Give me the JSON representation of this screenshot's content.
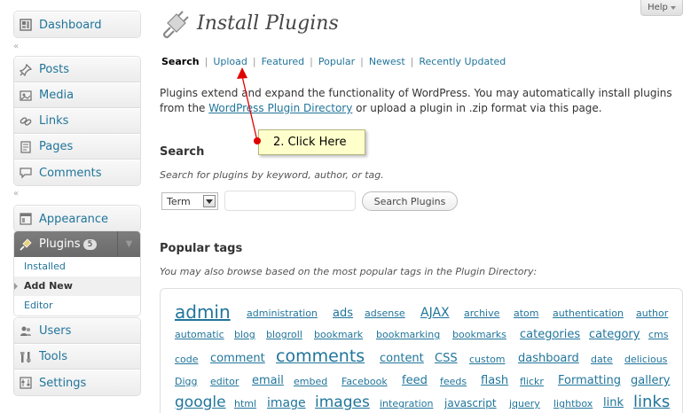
{
  "sidebar": {
    "top": {
      "label": "Dashboard",
      "icon": "dashboard-icon"
    },
    "content": [
      {
        "label": "Posts",
        "icon": "pin-icon"
      },
      {
        "label": "Media",
        "icon": "media-icon"
      },
      {
        "label": "Links",
        "icon": "link-icon"
      },
      {
        "label": "Pages",
        "icon": "page-icon"
      },
      {
        "label": "Comments",
        "icon": "comment-icon"
      }
    ],
    "appearance": {
      "label": "Appearance",
      "icon": "appearance-icon"
    },
    "plugins": {
      "label": "Plugins",
      "icon": "plug-icon",
      "badge": "5",
      "submenu": [
        {
          "label": "Installed"
        },
        {
          "label": "Add New"
        },
        {
          "label": "Editor"
        }
      ]
    },
    "bottom": [
      {
        "label": "Users",
        "icon": "users-icon"
      },
      {
        "label": "Tools",
        "icon": "tools-icon"
      },
      {
        "label": "Settings",
        "icon": "settings-icon"
      }
    ]
  },
  "help": {
    "label": "Help"
  },
  "page": {
    "title": "Install Plugins",
    "tabs": [
      {
        "label": "Search"
      },
      {
        "label": "Upload"
      },
      {
        "label": "Featured"
      },
      {
        "label": "Popular"
      },
      {
        "label": "Newest"
      },
      {
        "label": "Recently Updated"
      }
    ],
    "description_before": "Plugins extend and expand the functionality of WordPress. You may automatically install plugins from the ",
    "description_link": "WordPress Plugin Directory",
    "description_after": " or upload a plugin in .zip format via this page."
  },
  "search": {
    "heading": "Search",
    "hint": "Search for plugins by keyword, author, or tag.",
    "term_select": "Term",
    "input_value": "",
    "button": "Search Plugins"
  },
  "popular": {
    "heading": "Popular tags",
    "hint": "You may also browse based on the most popular tags in the Plugin Directory:",
    "tags": [
      "admin",
      "administration",
      "ads",
      "adsense",
      "AJAX",
      "archive",
      "atom",
      "authentication",
      "author",
      "automatic",
      "blog",
      "blogroll",
      "bookmark",
      "bookmarking",
      "bookmarks",
      "categories",
      "category",
      "cms",
      "code",
      "comment",
      "comments",
      "content",
      "CSS",
      "custom",
      "dashboard",
      "date",
      "delicious",
      "Digg",
      "editor",
      "email",
      "embed",
      "Facebook",
      "feed",
      "feeds",
      "flash",
      "flickr",
      "Formatting",
      "gallery",
      "google",
      "html",
      "image",
      "images",
      "integration",
      "javascript",
      "jquery",
      "lightbox",
      "link",
      "links"
    ]
  },
  "callout": {
    "label": "2. Click Here"
  },
  "colors": {
    "link": "#21759b",
    "callout_bg": "#ffffcc",
    "arrow": "#e00000"
  }
}
